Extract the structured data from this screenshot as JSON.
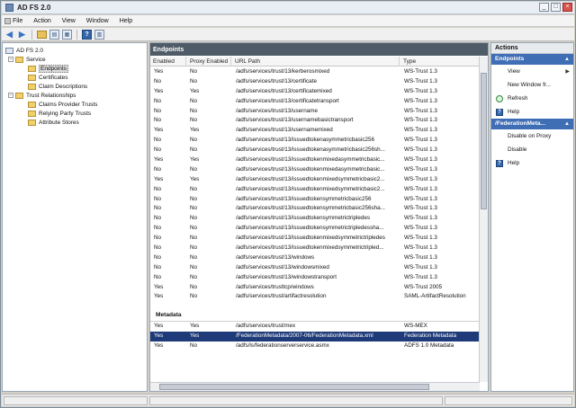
{
  "window": {
    "title": "AD FS 2.0",
    "icon": "adfs-app-icon"
  },
  "menu": [
    "File",
    "Action",
    "View",
    "Window",
    "Help"
  ],
  "tree": {
    "root": "AD FS 2.0",
    "service": "Service",
    "service_children": [
      "Endpoints",
      "Certificates",
      "Claim Descriptions"
    ],
    "trust": "Trust Relationships",
    "trust_children": [
      "Claims Provider Trusts",
      "Relying Party Trusts",
      "Attribute Stores"
    ]
  },
  "center": {
    "header": "Endpoints",
    "columns": [
      "Enabled",
      "Proxy Enabled",
      "URL Path",
      "Type"
    ],
    "rows": [
      [
        "Yes",
        "No",
        "/adfs/services/trust/13/kerberosmixed",
        "WS-Trust 1.3"
      ],
      [
        "No",
        "No",
        "/adfs/services/trust/13/certificate",
        "WS-Trust 1.3"
      ],
      [
        "Yes",
        "Yes",
        "/adfs/services/trust/13/certificatemixed",
        "WS-Trust 1.3"
      ],
      [
        "No",
        "No",
        "/adfs/services/trust/13/certificatetransport",
        "WS-Trust 1.3"
      ],
      [
        "No",
        "No",
        "/adfs/services/trust/13/username",
        "WS-Trust 1.3"
      ],
      [
        "No",
        "No",
        "/adfs/services/trust/13/usernamebasictransport",
        "WS-Trust 1.3"
      ],
      [
        "Yes",
        "Yes",
        "/adfs/services/trust/13/usernamemixed",
        "WS-Trust 1.3"
      ],
      [
        "No",
        "No",
        "/adfs/services/trust/13/issuedtokenasymmetricbasic256",
        "WS-Trust 1.3"
      ],
      [
        "No",
        "No",
        "/adfs/services/trust/13/issuedtokenasymmetricbasic256sh...",
        "WS-Trust 1.3"
      ],
      [
        "Yes",
        "Yes",
        "/adfs/services/trust/13/issuedtokenmixedasymmetricbasic...",
        "WS-Trust 1.3"
      ],
      [
        "No",
        "No",
        "/adfs/services/trust/13/issuedtokenmixedasymmetricbasic...",
        "WS-Trust 1.3"
      ],
      [
        "Yes",
        "Yes",
        "/adfs/services/trust/13/issuedtokenmixedsymmetricbasic2...",
        "WS-Trust 1.3"
      ],
      [
        "No",
        "No",
        "/adfs/services/trust/13/issuedtokenmixedsymmetricbasic2...",
        "WS-Trust 1.3"
      ],
      [
        "No",
        "No",
        "/adfs/services/trust/13/issuedtokensymmetricbasic256",
        "WS-Trust 1.3"
      ],
      [
        "No",
        "No",
        "/adfs/services/trust/13/issuedtokensymmetricbasic256sha...",
        "WS-Trust 1.3"
      ],
      [
        "No",
        "No",
        "/adfs/services/trust/13/issuedtokensymmetrictripledes",
        "WS-Trust 1.3"
      ],
      [
        "No",
        "No",
        "/adfs/services/trust/13/issuedtokensymmetrictripledessha...",
        "WS-Trust 1.3"
      ],
      [
        "No",
        "No",
        "/adfs/services/trust/13/issuedtokenmixedsymmetrictripledes",
        "WS-Trust 1.3"
      ],
      [
        "No",
        "No",
        "/adfs/services/trust/13/issuedtokenmixedsymmetrictripled...",
        "WS-Trust 1.3"
      ],
      [
        "No",
        "No",
        "/adfs/services/trust/13/windows",
        "WS-Trust 1.3"
      ],
      [
        "No",
        "No",
        "/adfs/services/trust/13/windowsmixed",
        "WS-Trust 1.3"
      ],
      [
        "No",
        "No",
        "/adfs/services/trust/13/windowstransport",
        "WS-Trust 1.3"
      ],
      [
        "Yes",
        "No",
        "/adfs/services/trusttcp/windows",
        "WS-Trust 2005"
      ],
      [
        "Yes",
        "No",
        "/adfs/services/trust/artifactresolution",
        "SAML-ArtifactResolution"
      ]
    ],
    "metadata_header": "Metadata",
    "metadata_rows": [
      [
        "Yes",
        "Yes",
        "/adfs/services/trust/mex",
        "WS-MEX"
      ],
      [
        "Yes",
        "Yes",
        "/FederationMetadata/2007-06/FederationMetadata.xml",
        "Federation Metadata"
      ],
      [
        "Yes",
        "No",
        "/adfs/ls/federationserverservice.asmx",
        "ADFS 1.0 Metadata"
      ]
    ],
    "selected_metadata_row": 1
  },
  "actions": {
    "title": "Actions",
    "section1": "Endpoints",
    "section1_items": [
      {
        "label": "View",
        "icon": "",
        "submenu": "▶"
      },
      {
        "label": "New Window fr...",
        "icon": ""
      },
      {
        "label": "Refresh",
        "icon": "refresh-icon"
      },
      {
        "label": "Help",
        "icon": "help-icon"
      }
    ],
    "section2": "/FederationMeta...",
    "section2_items": [
      {
        "label": "Disable on Proxy",
        "icon": ""
      },
      {
        "label": "Disable",
        "icon": ""
      },
      {
        "label": "Help",
        "icon": "help-icon"
      }
    ]
  },
  "colors": {
    "header_bg": "#4f5b66",
    "selection": "#1e3a78",
    "action_section": "#3f6eb5"
  }
}
